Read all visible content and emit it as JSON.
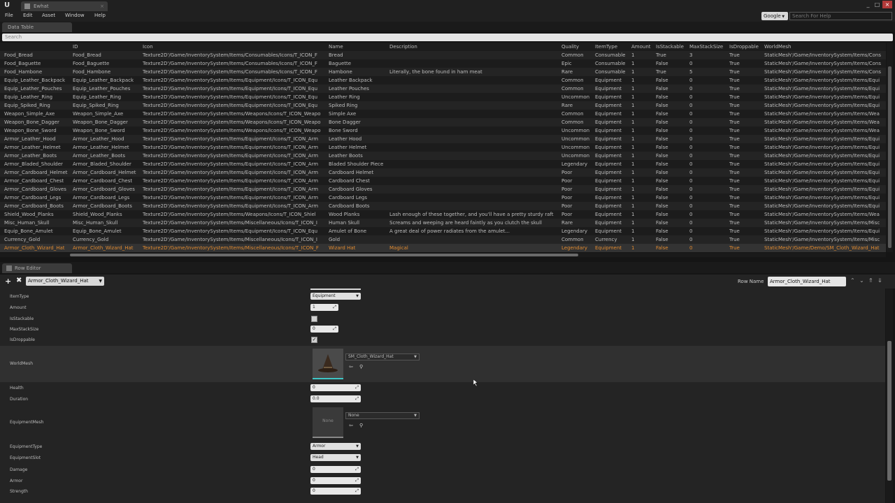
{
  "window": {
    "logo": "U",
    "tab_title": "Ewhat"
  },
  "menu": {
    "items": [
      "File",
      "Edit",
      "Asset",
      "Window",
      "Help"
    ],
    "search_provider": "Google",
    "search_placeholder": "Search For Help"
  },
  "data_table": {
    "tab_label": "Data Table",
    "search_placeholder": "Search",
    "columns": [
      "",
      "ID",
      "Icon",
      "Name",
      "Description",
      "Quality",
      "ItemType",
      "Amount",
      "IsStackable",
      "MaxStackSize",
      "IsDroppable",
      "WorldMesh"
    ],
    "rows": [
      [
        "Food_Bread",
        "Food_Bread",
        "Texture2D'/Game/InventorySystem/Items/Consumables/Icons/T_ICON_F",
        "Bread",
        "",
        "Common",
        "Consumable",
        "1",
        "True",
        "3",
        "True",
        "StaticMesh'/Game/InventorySystem/Items/Cons"
      ],
      [
        "Food_Baguette",
        "Food_Baguette",
        "Texture2D'/Game/InventorySystem/Items/Consumables/Icons/T_ICON_F",
        "Baguette",
        "",
        "Epic",
        "Consumable",
        "1",
        "False",
        "0",
        "True",
        "StaticMesh'/Game/InventorySystem/Items/Cons"
      ],
      [
        "Food_Hambone",
        "Food_Hambone",
        "Texture2D'/Game/InventorySystem/Items/Consumables/Icons/T_ICON_F",
        "Hambone",
        "Literally, the bone found in ham meat",
        "Rare",
        "Consumable",
        "1",
        "True",
        "5",
        "True",
        "StaticMesh'/Game/InventorySystem/Items/Cons"
      ],
      [
        "Equip_Leather_Backpack",
        "Equip_Leather_Backpack",
        "Texture2D'/Game/InventorySystem/Items/Equipment/Icons/T_ICON_Equ",
        "Leather Backpack",
        "",
        "Common",
        "Equipment",
        "1",
        "False",
        "0",
        "True",
        "StaticMesh'/Game/InventorySystem/Items/Equi"
      ],
      [
        "Equip_Leather_Pouches",
        "Equip_Leather_Pouches",
        "Texture2D'/Game/InventorySystem/Items/Equipment/Icons/T_ICON_Equ",
        "Leather Pouches",
        "",
        "Common",
        "Equipment",
        "1",
        "False",
        "0",
        "True",
        "StaticMesh'/Game/InventorySystem/Items/Equi"
      ],
      [
        "Equip_Leather_Ring",
        "Equip_Leather_Ring",
        "Texture2D'/Game/InventorySystem/Items/Equipment/Icons/T_ICON_Equ",
        "Leather Ring",
        "",
        "Uncommon",
        "Equipment",
        "1",
        "False",
        "0",
        "True",
        "StaticMesh'/Game/InventorySystem/Items/Equi"
      ],
      [
        "Equip_Spiked_Ring",
        "Equip_Spiked_Ring",
        "Texture2D'/Game/InventorySystem/Items/Equipment/Icons/T_ICON_Equ",
        "Spiked Ring",
        "",
        "Rare",
        "Equipment",
        "1",
        "False",
        "0",
        "True",
        "StaticMesh'/Game/InventorySystem/Items/Equi"
      ],
      [
        "Weapon_Simple_Axe",
        "Weapon_Simple_Axe",
        "Texture2D'/Game/InventorySystem/Items/Weapons/Icons/T_ICON_Weapo",
        "Simple Axe",
        "",
        "Common",
        "Equipment",
        "1",
        "False",
        "0",
        "True",
        "StaticMesh'/Game/InventorySystem/Items/Wea"
      ],
      [
        "Weapon_Bone_Dagger",
        "Weapon_Bone_Dagger",
        "Texture2D'/Game/InventorySystem/Items/Weapons/Icons/T_ICON_Weapo",
        "Bone Dagger",
        "",
        "Common",
        "Equipment",
        "1",
        "False",
        "0",
        "True",
        "StaticMesh'/Game/InventorySystem/Items/Wea"
      ],
      [
        "Weapon_Bone_Sword",
        "Weapon_Bone_Sword",
        "Texture2D'/Game/InventorySystem/Items/Weapons/Icons/T_ICON_Weapo",
        "Bone Sword",
        "",
        "Uncommon",
        "Equipment",
        "1",
        "False",
        "0",
        "True",
        "StaticMesh'/Game/InventorySystem/Items/Wea"
      ],
      [
        "Armor_Leather_Hood",
        "Armor_Leather_Hood",
        "Texture2D'/Game/InventorySystem/Items/Equipment/Icons/T_ICON_Arm",
        "Leather Hood",
        "",
        "Uncommon",
        "Equipment",
        "1",
        "False",
        "0",
        "True",
        "StaticMesh'/Game/InventorySystem/Items/Equi"
      ],
      [
        "Armor_Leather_Helmet",
        "Armor_Leather_Helmet",
        "Texture2D'/Game/InventorySystem/Items/Equipment/Icons/T_ICON_Arm",
        "Leather Helmet",
        "",
        "Uncommon",
        "Equipment",
        "1",
        "False",
        "0",
        "True",
        "StaticMesh'/Game/InventorySystem/Items/Equi"
      ],
      [
        "Armor_Leather_Boots",
        "Armor_Leather_Boots",
        "Texture2D'/Game/InventorySystem/Items/Equipment/Icons/T_ICON_Arm",
        "Leather Boots",
        "",
        "Uncommon",
        "Equipment",
        "1",
        "False",
        "0",
        "True",
        "StaticMesh'/Game/InventorySystem/Items/Equi"
      ],
      [
        "Armor_Bladed_Shoulder",
        "Armor_Bladed_Shoulder",
        "Texture2D'/Game/InventorySystem/Items/Equipment/Icons/T_ICON_Arm",
        "Bladed Shoulder Piece",
        "",
        "Legendary",
        "Equipment",
        "1",
        "False",
        "0",
        "True",
        "StaticMesh'/Game/InventorySystem/Items/Equi"
      ],
      [
        "Armor_Cardboard_Helmet",
        "Armor_Cardboard_Helmet",
        "Texture2D'/Game/InventorySystem/Items/Equipment/Icons/T_ICON_Arm",
        "Cardboard Helmet",
        "",
        "Poor",
        "Equipment",
        "1",
        "False",
        "0",
        "True",
        "StaticMesh'/Game/InventorySystem/Items/Equi"
      ],
      [
        "Armor_Cardboard_Chest",
        "Armor_Cardboard_Chest",
        "Texture2D'/Game/InventorySystem/Items/Equipment/Icons/T_ICON_Arm",
        "Cardboard Chest",
        "",
        "Poor",
        "Equipment",
        "1",
        "False",
        "0",
        "True",
        "StaticMesh'/Game/InventorySystem/Items/Equi"
      ],
      [
        "Armor_Cardboard_Gloves",
        "Armor_Cardboard_Gloves",
        "Texture2D'/Game/InventorySystem/Items/Equipment/Icons/T_ICON_Arm",
        "Cardboard Gloves",
        "",
        "Poor",
        "Equipment",
        "1",
        "False",
        "0",
        "True",
        "StaticMesh'/Game/InventorySystem/Items/Equi"
      ],
      [
        "Armor_Cardboard_Legs",
        "Armor_Cardboard_Legs",
        "Texture2D'/Game/InventorySystem/Items/Equipment/Icons/T_ICON_Arm",
        "Cardboard Legs",
        "",
        "Poor",
        "Equipment",
        "1",
        "False",
        "0",
        "True",
        "StaticMesh'/Game/InventorySystem/Items/Equi"
      ],
      [
        "Armor_Cardboard_Boots",
        "Armor_Cardboard_Boots",
        "Texture2D'/Game/InventorySystem/Items/Equipment/Icons/T_ICON_Arm",
        "Cardboard Boots",
        "",
        "Poor",
        "Equipment",
        "1",
        "False",
        "0",
        "True",
        "StaticMesh'/Game/InventorySystem/Items/Equi"
      ],
      [
        "Shield_Wood_Planks",
        "Shield_Wood_Planks",
        "Texture2D'/Game/InventorySystem/Items/Weapons/Icons/T_ICON_Shiel",
        "Wood Planks",
        "Lash enough of these together, and you'll have a pretty sturdy raft",
        "Poor",
        "Equipment",
        "1",
        "False",
        "0",
        "True",
        "StaticMesh'/Game/InventorySystem/Items/Wea"
      ],
      [
        "Misc_Human_Skull",
        "Misc_Human_Skull",
        "Texture2D'/Game/InventorySystem/Items/Miscellaneous/Icons/T_ICON_I",
        "Human Skull",
        "Screams and weeping are heard faintly as you clutch the skull",
        "Rare",
        "Equipment",
        "1",
        "False",
        "0",
        "True",
        "StaticMesh'/Game/InventorySystem/Items/Misc"
      ],
      [
        "Equip_Bone_Amulet",
        "Equip_Bone_Amulet",
        "Texture2D'/Game/InventorySystem/Items/Equipment/Icons/T_ICON_Equ",
        "Amulet of Bone",
        "A great deal of power radiates from the amulet...",
        "Legendary",
        "Equipment",
        "1",
        "False",
        "0",
        "True",
        "StaticMesh'/Game/InventorySystem/Items/Equi"
      ],
      [
        "Currency_Gold",
        "Currency_Gold",
        "Texture2D'/Game/InventorySystem/Items/Miscellaneous/Icons/T_ICON_I",
        "Gold",
        "",
        "Common",
        "Currency",
        "1",
        "False",
        "0",
        "True",
        "StaticMesh'/Game/InventorySystem/Items/Misc"
      ],
      [
        "Armor_Cloth_Wizard_Hat",
        "Armor_Cloth_Wizard_Hat",
        "Texture2D'/Game/InventorySystem/Items/Miscellaneous/Icons/T_ICON_F",
        "Wizard Hat",
        "Magical",
        "Legendary",
        "Equipment",
        "1",
        "False",
        "0",
        "True",
        "StaticMesh'/Game/Demo/SM_Cloth_Wizard_Hat"
      ]
    ],
    "selected_row_index": 23
  },
  "row_editor": {
    "tab_label": "Row Editor",
    "selected_row": "Armor_Cloth_Wizard_Hat",
    "row_name_label": "Row Name",
    "row_name_value": "Armor_Cloth_Wizard_Hat",
    "props": {
      "item_type_label": "ItemType",
      "item_type_value": "Equipment",
      "amount_label": "Amount",
      "amount_value": "1",
      "is_stackable_label": "IsStackable",
      "is_stackable_checked": false,
      "max_stack_label": "MaxStackSize",
      "max_stack_value": "0",
      "is_droppable_label": "IsDroppable",
      "is_droppable_checked": true,
      "world_mesh_label": "WorldMesh",
      "world_mesh_value": "SM_Cloth_Wizard_Hat",
      "health_label": "Health",
      "health_value": "0",
      "duration_label": "Duration",
      "duration_value": "0.0",
      "equipment_mesh_label": "EquipmentMesh",
      "equipment_mesh_thumb": "None",
      "equipment_mesh_value": "None",
      "equipment_type_label": "EquipmentType",
      "equipment_type_value": "Armor",
      "equipment_slot_label": "EquipmentSlot",
      "equipment_slot_value": "Head",
      "damage_label": "Damage",
      "damage_value": "0",
      "armor_label": "Armor",
      "armor_value": "0",
      "strength_label": "Strength",
      "strength_value": "0"
    }
  },
  "colors": {
    "selected_text": "#e08a30",
    "thumbnail_accent": "#3ec6c6",
    "close_button": "#b23a3a"
  }
}
